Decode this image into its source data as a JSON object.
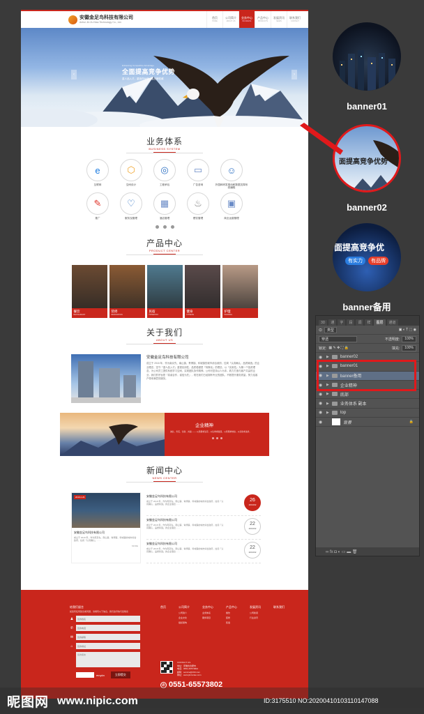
{
  "header": {
    "logo_name": "安徽金足鸟科技有限公司",
    "logo_en": "Anhui Jin Zu Niao Technology Co., Ltd.",
    "nav": [
      {
        "cn": "首页",
        "en": "HOME"
      },
      {
        "cn": "公司简介",
        "en": "ABOUT US"
      },
      {
        "cn": "业务中心",
        "en": "BUSINESS"
      },
      {
        "cn": "产品中心",
        "en": "PRODUCTS"
      },
      {
        "cn": "发展资讯",
        "en": "NEWS"
      },
      {
        "cn": "联系我们",
        "en": "CONTACT"
      }
    ],
    "active_index": 2
  },
  "banner": {
    "small": "Enhancing Competitive Advantage",
    "title": "全面提高竞争优势",
    "sub": "重人品入才，重信任伙伴，重品牌权威",
    "prev": "‹",
    "next": "›"
  },
  "business": {
    "title": "业务体系",
    "en": "BUSINESS SYSTEM",
    "items": [
      {
        "icon": "e",
        "label": "互联网"
      },
      {
        "icon": "⬡",
        "label": "空间设计"
      },
      {
        "icon": "◎",
        "label": "工程承包"
      },
      {
        "icon": "▭",
        "label": "广告咨询"
      },
      {
        "icon": "☺",
        "label": "外国和研发推动和数据支撑系统编程"
      },
      {
        "icon": "✎",
        "label": "推广"
      },
      {
        "icon": "♡",
        "label": "服务及管理"
      },
      {
        "icon": "▦",
        "label": "酒店管理"
      },
      {
        "icon": "♨",
        "label": "餐饮管理"
      },
      {
        "icon": "▣",
        "label": "商业运营管理"
      }
    ]
  },
  "products": {
    "title": "产品中心",
    "en": "PRODUCT CENTER",
    "items": [
      {
        "cn": "餐饮",
        "en": "RESTAURANT",
        "color": "#6b4a32"
      },
      {
        "cn": "装修",
        "en": "RENOVATION",
        "color": "#8a5a34"
      },
      {
        "cn": "民宿",
        "en": "HOMESTAY",
        "color": "#4f7a8f"
      },
      {
        "cn": "健身",
        "en": "FITNESS",
        "color": "#5a4a4a"
      },
      {
        "cn": "护理",
        "en": "NURSING",
        "color": "#b89a86"
      }
    ]
  },
  "about": {
    "title": "关于我们",
    "en": "ABOUT US",
    "company": "安徽金足鸟科技有限公司",
    "text": "成立于 2018 年，作为南京先、南山镇、青博镇、科城镇的城市综合政府，拉闻「认真确认，品质铸造」的企业理念，坚守「重人品入才」重视实用性，品质稳健是「特殊化」的理念，以「实用性」为第一个投资理念。为公司员工提供系统学习空间，实现团队协作精神。公司可坚持以人为本，着力打造与客户共赢的企业，我们的宗旨是「真诚合作，诚信为先」，现在我们已经拥有专业的团队，不断提升服务质量，努力给客户带来满意的服务。"
  },
  "spirit": {
    "title": "企业精神",
    "text": "诚信、务实、创新、共赢 —— 以质量求生存，以信誉求发展，以管理求效益，以创新求进步。"
  },
  "news": {
    "title": "新闻中心",
    "en": "NEWS CENTER",
    "feature": {
      "date_tag": "2019.2.26",
      "title": "安徽金足鸟科技有限公司",
      "text": "成立于 2018 年，作为南京先、南山镇、青博镇，科城镇的城市综合政府，拉闻「认真确认」……",
      "more": "MORE"
    },
    "items": [
      {
        "title": "安徽金足鸟科技有限公司",
        "text": "成立于 2018 年，作为南京先、南山镇、青博镇、科城镇的城市综合政府，拉闻「认真确认，品质铸造」的企业理念……",
        "day": "26",
        "ym": "2019/02",
        "hot": true
      },
      {
        "title": "安徽金足鸟科技有限公司",
        "text": "成立于 2018 年，作为南京先、南山镇、青博镇、科城镇的城市综合政府，拉闻「认真确认，品质铸造」的企业理念……",
        "day": "22",
        "ym": "2019/02",
        "hot": false
      },
      {
        "title": "安徽金足鸟科技有限公司",
        "text": "成立于 2018 年，作为南京先、南山镇、青博镇、科城镇的城市综合政府，拉闻「认真确认，品质铸造」的企业理念……",
        "day": "22",
        "ym": "2019/02",
        "hot": false
      }
    ]
  },
  "footer": {
    "msg_title": "给我们留言",
    "msg_sub": "如您有任何建议或问题，请填写以下信息，我们会尽快与您联系",
    "fields": [
      {
        "icon": "♟",
        "placeholder": "您的姓名"
      },
      {
        "icon": "✆",
        "placeholder": "您的电话"
      },
      {
        "icon": "✉",
        "placeholder": "您的邮箱"
      },
      {
        "icon": "⌂",
        "placeholder": "您的地址"
      }
    ],
    "textarea": "您的留言",
    "verify_code": "emyka",
    "submit": "立即提交",
    "columns": [
      {
        "head": "首页",
        "items": []
      },
      {
        "head": "公司简介",
        "items": [
          "公司简介",
          "企业文化",
          "组织架构"
        ]
      },
      {
        "head": "业务中心",
        "items": [
          "业务体系",
          "服务项目"
        ]
      },
      {
        "head": "产品中心",
        "items": [
          "餐饮",
          "装修",
          "民宿"
        ]
      },
      {
        "head": "发展资讯",
        "items": [
          "公司新闻",
          "行业资讯"
        ]
      },
      {
        "head": "联系我们",
        "items": []
      }
    ],
    "contact": "CONTACT US\n地址：安徽省合肥市\n电话：0551-65573802\n邮箱：service@163.com\n网址：www.jinzuniao.com",
    "phone": "0551-65573802"
  },
  "side": {
    "banner01": "banner01",
    "banner02": "banner02",
    "banner_backup": "banner备用",
    "thumb02_text": "面提高竞争优势",
    "thumb03_text": "面提高竞争优",
    "thumb03_badge1": "有实力",
    "thumb03_badge2": "有品牌"
  },
  "ps_panel": {
    "tabs": [
      "3D",
      "通",
      "字",
      "段",
      "调",
      "样",
      "图层",
      "通道"
    ],
    "kind": "类型",
    "blend": "穿透",
    "opacity_label": "不透明度:",
    "opacity": "100%",
    "lock_label": "锁定:",
    "fill_label": "填充:",
    "fill": "100%",
    "layers": [
      {
        "name": "banner02",
        "selected": false,
        "group": true
      },
      {
        "name": "banner01",
        "selected": false,
        "group": true
      },
      {
        "name": "banner备用",
        "selected": true,
        "group": true
      },
      {
        "name": "企业精神",
        "selected": false,
        "group": true
      },
      {
        "name": "底部",
        "selected": false,
        "group": true
      },
      {
        "name": "业务体系 副本",
        "selected": false,
        "group": true
      },
      {
        "name": "top",
        "selected": false,
        "group": true
      },
      {
        "name": "背景",
        "selected": false,
        "group": false
      }
    ],
    "footer_icons": "∞  fx  ◘  ◐  ▭  ▬  🗑"
  },
  "watermark": {
    "logo": "昵图网",
    "url": "www.nipic.com",
    "id": "ID:3175510 NO:20200410103110147088"
  },
  "colors": {
    "accent": "#c9261c",
    "backdrop": "#3a3a3a"
  }
}
